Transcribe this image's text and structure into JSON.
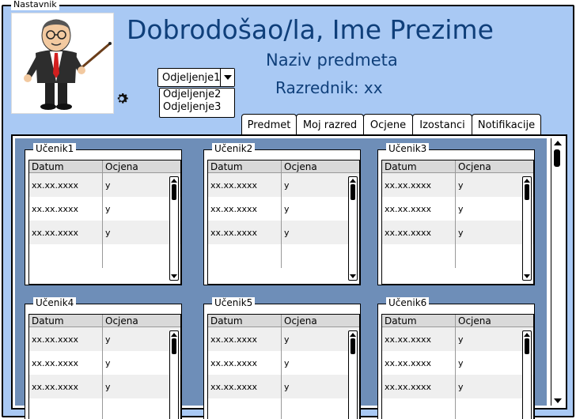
{
  "window": {
    "title": "Nastavnik"
  },
  "header": {
    "welcome": "Dobrodošao/la, Ime Prezime",
    "subject": "Naziv predmeta",
    "homeroom": "Razrednik: xx"
  },
  "class_select": {
    "value": "Odjeljenje1",
    "options": [
      "Odjeljenje2",
      "Odjeljenje3"
    ]
  },
  "tabs": [
    "Predmet",
    "Moj razred",
    "Ocjene",
    "Izostanci",
    "Notifikacije"
  ],
  "columns": {
    "date": "Datum",
    "grade": "Ocjena"
  },
  "students": [
    {
      "name": "Učenik1",
      "rows": [
        {
          "date": "xx.xx.xxxx",
          "grade": "y"
        },
        {
          "date": "xx.xx.xxxx",
          "grade": "y"
        },
        {
          "date": "xx.xx.xxxx",
          "grade": "y"
        }
      ]
    },
    {
      "name": "Učenik2",
      "rows": [
        {
          "date": "xx.xx.xxxx",
          "grade": "y"
        },
        {
          "date": "xx.xx.xxxx",
          "grade": "y"
        },
        {
          "date": "xx.xx.xxxx",
          "grade": "y"
        }
      ]
    },
    {
      "name": "Učenik3",
      "rows": [
        {
          "date": "xx.xx.xxxx",
          "grade": "y"
        },
        {
          "date": "xx.xx.xxxx",
          "grade": "y"
        },
        {
          "date": "xx.xx.xxxx",
          "grade": "y"
        }
      ]
    },
    {
      "name": "Učenik4",
      "rows": [
        {
          "date": "xx.xx.xxxx",
          "grade": "y"
        },
        {
          "date": "xx.xx.xxxx",
          "grade": "y"
        },
        {
          "date": "xx.xx.xxxx",
          "grade": "y"
        }
      ]
    },
    {
      "name": "Učenik5",
      "rows": [
        {
          "date": "xx.xx.xxxx",
          "grade": "y"
        },
        {
          "date": "xx.xx.xxxx",
          "grade": "y"
        },
        {
          "date": "xx.xx.xxxx",
          "grade": "y"
        }
      ]
    },
    {
      "name": "Učenik6",
      "rows": [
        {
          "date": "xx.xx.xxxx",
          "grade": "y"
        },
        {
          "date": "xx.xx.xxxx",
          "grade": "y"
        },
        {
          "date": "xx.xx.xxxx",
          "grade": "y"
        }
      ]
    }
  ],
  "icons": {
    "settings": "gear-icon",
    "avatar": "teacher-avatar"
  },
  "colors": {
    "background": "#a9c9f4",
    "title": "#0f3f7a",
    "panel": "#6e8eb8"
  }
}
